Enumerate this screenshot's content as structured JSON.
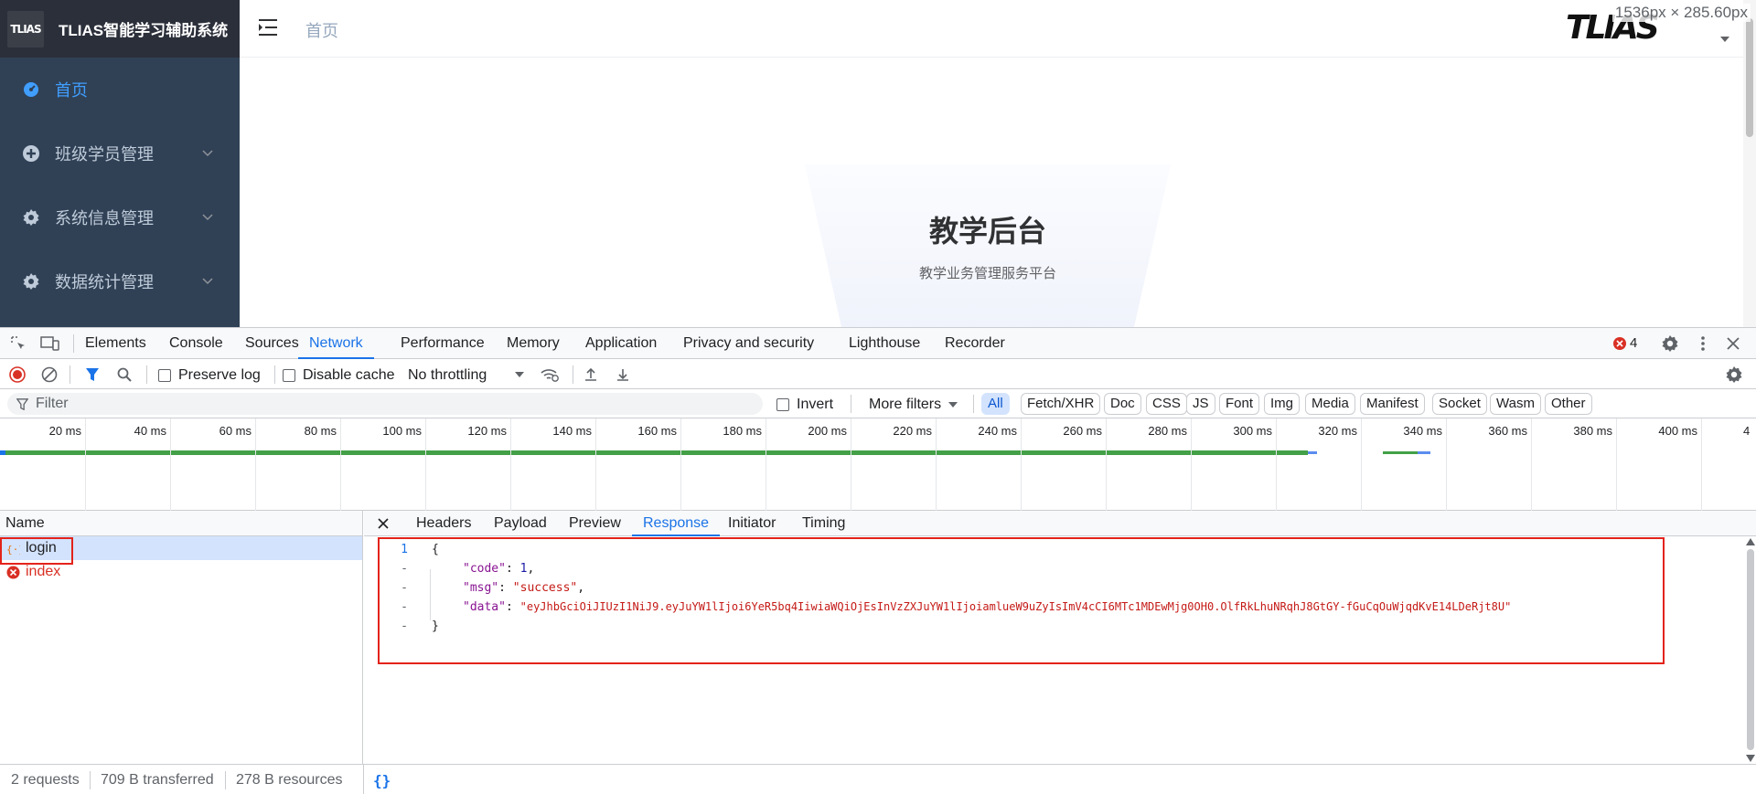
{
  "app": {
    "brand_logo_text": "TLIAS",
    "brand_title": "TLIAS智能学习辅助系统",
    "menu": [
      {
        "label": "首页",
        "active": true,
        "icon": "dashboard-icon"
      },
      {
        "label": "班级学员管理",
        "active": false,
        "icon": "plus-circle-icon"
      },
      {
        "label": "系统信息管理",
        "active": false,
        "icon": "gear-icon"
      },
      {
        "label": "数据统计管理",
        "active": false,
        "icon": "gear-icon"
      }
    ],
    "breadcrumb": "首页",
    "header_logo_text": "TLIAS",
    "size_tooltip": "1536px × 285.60px",
    "hero_title": "教学后台",
    "hero_subtitle": "教学业务管理服务平台"
  },
  "devtools": {
    "tabs": [
      "Elements",
      "Console",
      "Sources",
      "Network",
      "Performance",
      "Memory",
      "Application",
      "Privacy and security",
      "Lighthouse",
      "Recorder"
    ],
    "active_tab": "Network",
    "error_count": "4",
    "toolbar": {
      "preserve_log": "Preserve log",
      "disable_cache": "Disable cache",
      "throttling": "No throttling"
    },
    "filter": {
      "placeholder": "Filter",
      "invert": "Invert",
      "more_filters": "More filters",
      "types": [
        "All",
        "Fetch/XHR",
        "Doc",
        "CSS",
        "JS",
        "Font",
        "Img",
        "Media",
        "Manifest",
        "Socket",
        "Wasm",
        "Other"
      ],
      "active_type": "All"
    },
    "timeline_ticks": [
      "20 ms",
      "40 ms",
      "60 ms",
      "80 ms",
      "100 ms",
      "120 ms",
      "140 ms",
      "160 ms",
      "180 ms",
      "200 ms",
      "220 ms",
      "240 ms",
      "260 ms",
      "280 ms",
      "300 ms",
      "320 ms",
      "340 ms",
      "360 ms",
      "380 ms",
      "400 ms",
      "4"
    ],
    "requests": {
      "header": "Name",
      "items": [
        {
          "name": "login",
          "status": "xhr",
          "selected": true
        },
        {
          "name": "index",
          "status": "error",
          "selected": false
        }
      ]
    },
    "detail_tabs": [
      "Headers",
      "Payload",
      "Preview",
      "Response",
      "Initiator",
      "Timing"
    ],
    "active_detail_tab": "Response",
    "response": {
      "line_numbers": [
        "1",
        "-",
        "-",
        "-",
        "-"
      ],
      "open_brace": "{",
      "close_brace": "}",
      "code_key": "\"code\"",
      "code_value": "1",
      "msg_key": "\"msg\"",
      "msg_value": "\"success\"",
      "data_key": "\"data\"",
      "data_value": "\"eyJhbGciOiJIUzI1NiJ9.eyJuYW1lIjoi6YeR5bq4IiwiaWQiOjEsInVzZXJuYW1lIjoiamlueW9uZyIsImV4cCI6MTc1MDEwMjg0OH0.OlfRkLhuNRqhJ8GtGY-fGuCqOuWjqdKvE14LDeRjt8U\""
    },
    "status": {
      "requests": "2 requests",
      "transferred": "709 B transferred",
      "resources": "278 B resources",
      "format_icon": "{}"
    }
  },
  "colors": {
    "sidebar_bg": "#304156",
    "accent": "#409eff",
    "devtools_accent": "#1a73e8",
    "highlight_red": "#e3231a"
  }
}
